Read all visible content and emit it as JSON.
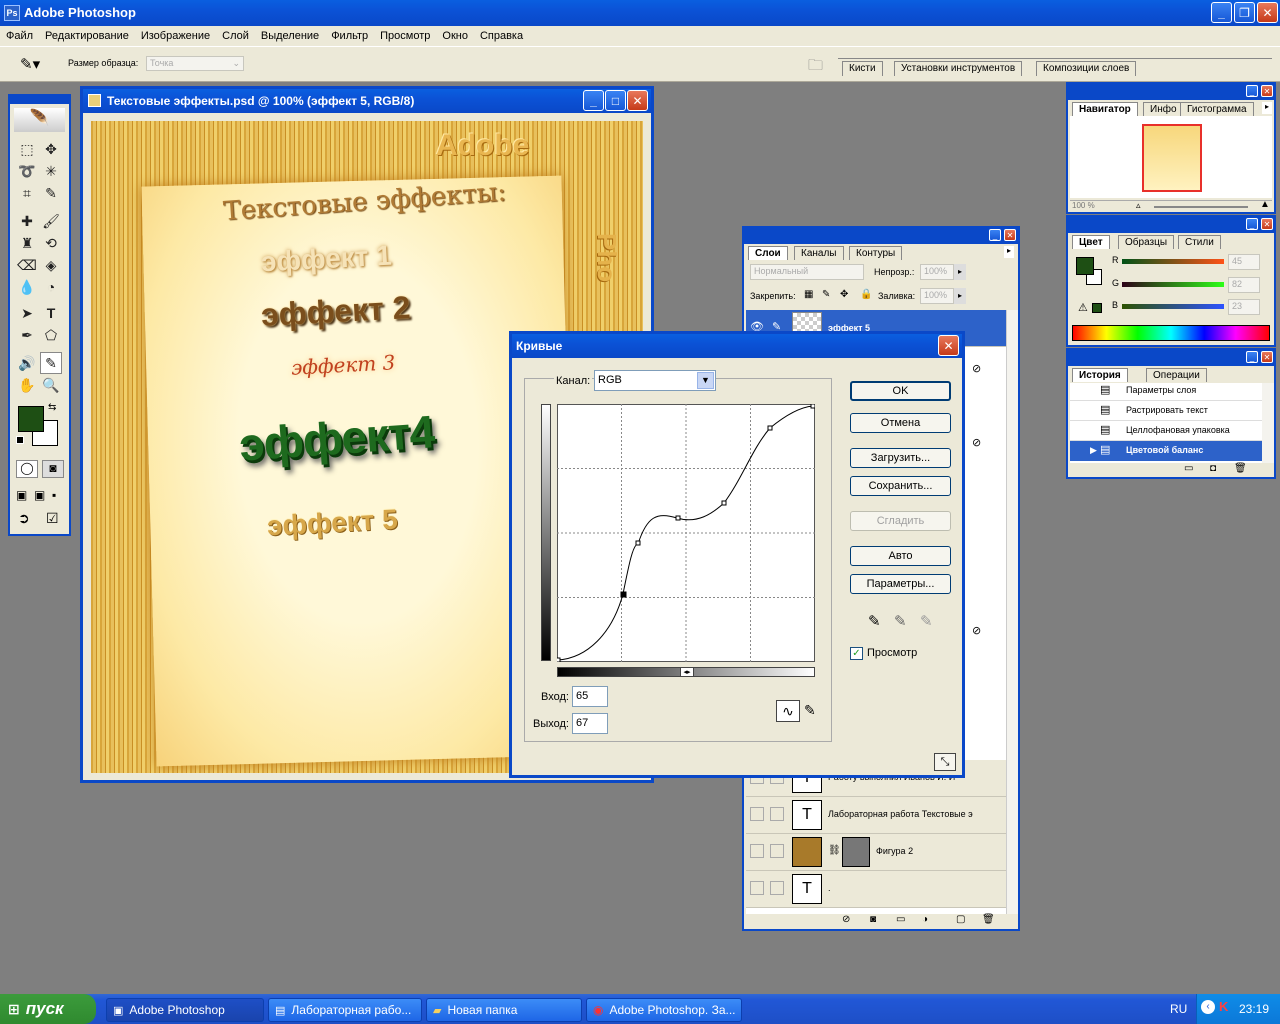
{
  "app": {
    "title": "Adobe Photoshop",
    "menu": [
      "Файл",
      "Редактирование",
      "Изображение",
      "Слой",
      "Выделение",
      "Фильтр",
      "Просмотр",
      "Окно",
      "Справка"
    ]
  },
  "options_bar": {
    "sample_size_label": "Размер образца:",
    "sample_size_value": "Точка",
    "palette_tabs": [
      "Кисти",
      "Установки инструментов",
      "Композиции слоев"
    ]
  },
  "document": {
    "title": "Текстовые эффекты.psd @ 100% (эффект 5, RGB/8)",
    "heading": "Текстовые эффекты:",
    "adobe_text": "Adobe",
    "side_text": "Pho",
    "effects": [
      "эффект 1",
      "эффект 2",
      "эффект 3",
      "эффект4",
      "эффект 5"
    ]
  },
  "navigator": {
    "tabs": [
      "Навигатор",
      "Инфо",
      "Гистограмма"
    ],
    "zoom": "100 %"
  },
  "color_panel": {
    "tabs": [
      "Цвет",
      "Образцы",
      "Стили"
    ],
    "r_label": "R",
    "g_label": "G",
    "b_label": "B",
    "r": "45",
    "g": "82",
    "b": "23",
    "foreground": "#1e4f14"
  },
  "history": {
    "tabs": [
      "История",
      "Операции"
    ],
    "items": [
      "Параметры слоя",
      "Растрировать текст",
      "Целлофановая упаковка",
      "Цветовой баланс"
    ]
  },
  "layers": {
    "tabs": [
      "Слои",
      "Каналы",
      "Контуры"
    ],
    "blend_mode": "Нормальный",
    "opacity_label": "Непрозр.:",
    "opacity": "100%",
    "lock_label": "Закрепить:",
    "fill_label": "Заливка:",
    "fill": "100%",
    "top_layer": "эффект 5",
    "rows": [
      "Работу выполнил Иванов И. И",
      "Лабораторная работа Текстовые э",
      "Фигура 2",
      "."
    ]
  },
  "curves": {
    "title": "Кривые",
    "channel_label": "Канал:",
    "channel": "RGB",
    "ok": "OK",
    "cancel": "Отмена",
    "load": "Загрузить...",
    "save": "Сохранить...",
    "smooth": "Сгладить",
    "auto": "Авто",
    "options": "Параметры...",
    "preview": "Просмотр",
    "input_label": "Вход:",
    "input": "65",
    "output_label": "Выход:",
    "output": "67"
  },
  "taskbar": {
    "start": "пуск",
    "items": [
      "Adobe Photoshop",
      "Лабораторная рабо...",
      "Новая папка",
      "Adobe Photoshop. За..."
    ],
    "lang": "RU",
    "clock": "23:19"
  }
}
